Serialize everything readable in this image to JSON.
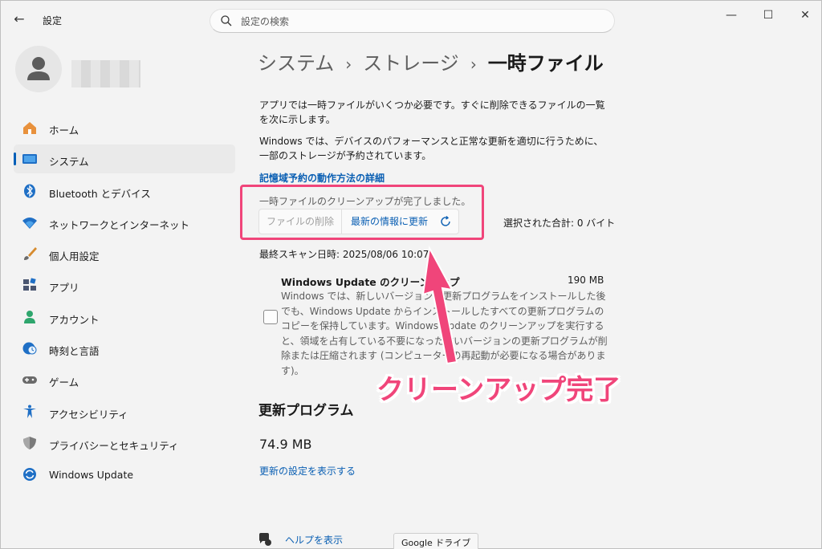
{
  "window": {
    "app_title": "設定",
    "search_placeholder": "設定の検索",
    "minimize": "—",
    "maximize": "☐",
    "close": "✕"
  },
  "sidebar": {
    "items": [
      {
        "label": "ホーム",
        "icon": "home-icon"
      },
      {
        "label": "システム",
        "icon": "system-icon",
        "active": true
      },
      {
        "label": "Bluetooth とデバイス",
        "icon": "bluetooth-icon"
      },
      {
        "label": "ネットワークとインターネット",
        "icon": "wifi-icon"
      },
      {
        "label": "個人用設定",
        "icon": "brush-icon"
      },
      {
        "label": "アプリ",
        "icon": "apps-icon"
      },
      {
        "label": "アカウント",
        "icon": "account-icon"
      },
      {
        "label": "時刻と言語",
        "icon": "globe-clock-icon"
      },
      {
        "label": "ゲーム",
        "icon": "gamepad-icon"
      },
      {
        "label": "アクセシビリティ",
        "icon": "accessibility-icon"
      },
      {
        "label": "プライバシーとセキュリティ",
        "icon": "shield-icon"
      },
      {
        "label": "Windows Update",
        "icon": "windows-update-icon"
      }
    ]
  },
  "breadcrumb": {
    "parent1": "システム",
    "parent2": "ストレージ",
    "current": "一時ファイル",
    "separator": "›"
  },
  "main": {
    "intro1": "アプリでは一時ファイルがいくつか必要です。すぐに削除できるファイルの一覧を次に示します。",
    "intro2": "Windows では、デバイスのパフォーマンスと正常な更新を適切に行うために、一部のストレージが予約されています。",
    "memory_link": "記憶域予約の動作方法の詳細",
    "cleanup_status": "一時ファイルのクリーンアップが完了しました。",
    "delete_button": "ファイルの削除",
    "refresh_button": "最新の情報に更新",
    "selected_total": "選択された合計: 0 バイト",
    "last_scan": "最終スキャン日時: 2025/08/06 10:07",
    "windows_update_item": {
      "title": "Windows Update のクリーンアップ",
      "size": "190 MB",
      "description": "Windows では、新しいバージョンの更新プログラムをインストールした後でも、Windows Update からインストールしたすべての更新プログラムのコピーを保持しています。Windows Update のクリーンアップを実行すると、領域を占有している不要になった古いバージョンの更新プログラムが削除または圧縮されます (コンピューターの再起動が必要になる場合があります)。"
    },
    "updates_section_title": "更新プログラム",
    "updates_size": "74.9 MB",
    "updates_link": "更新の設定を表示する",
    "help_link": "ヘルプを表示"
  },
  "annotation": {
    "callout_text": "クリーンアップ完了",
    "color": "#f0457a"
  },
  "tooltip": {
    "text": "Google ドライブ"
  },
  "colors": {
    "accent": "#005fb8",
    "link": "#0a5fb3",
    "background": "#f3f3f3"
  }
}
